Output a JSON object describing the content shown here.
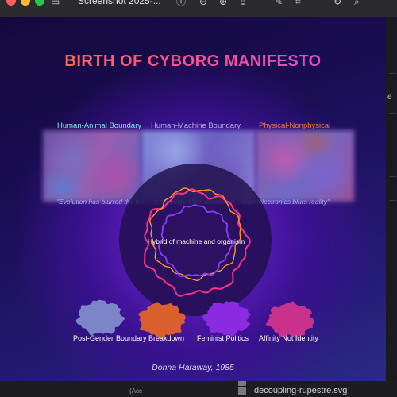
{
  "window": {
    "title": "Screenshot 2025-...",
    "toolbar_icons": [
      "sidebar-icon",
      "info-icon",
      "markup-icon",
      "zoom-out-icon",
      "zoom-in-icon",
      "share-icon",
      "edit-icon",
      "search-icon"
    ]
  },
  "artwork": {
    "title": "BIRTH OF CYBORG MANIFESTO",
    "boundaries": [
      {
        "label": "Human-Animal Boundary",
        "color": "#8be4f0"
      },
      {
        "label": "Human-Machine Boundary",
        "color": "#b8b3e6"
      },
      {
        "label": "Physical-Nonphysical",
        "color": "#ff7a3c"
      }
    ],
    "quote": "\"Evolution has blurred the line... technology blurs distinction... microelectronics blurs reality\"",
    "core_label": "Hybrid of machine and organism",
    "themes": [
      {
        "label": "Post-Gender",
        "color": "#7b86c6"
      },
      {
        "label": "Boundary Breakdown",
        "color": "#d9602e"
      },
      {
        "label": "Feminist Politics",
        "color": "#8a2be2"
      },
      {
        "label": "Affinity Not Identity",
        "color": "#c8328c"
      }
    ],
    "credit": "Donna Haraway, 1985"
  },
  "background_app": {
    "bottom_left_text": "(Acc",
    "files": [
      "",
      "decoupling-rupestre.svg"
    ]
  }
}
